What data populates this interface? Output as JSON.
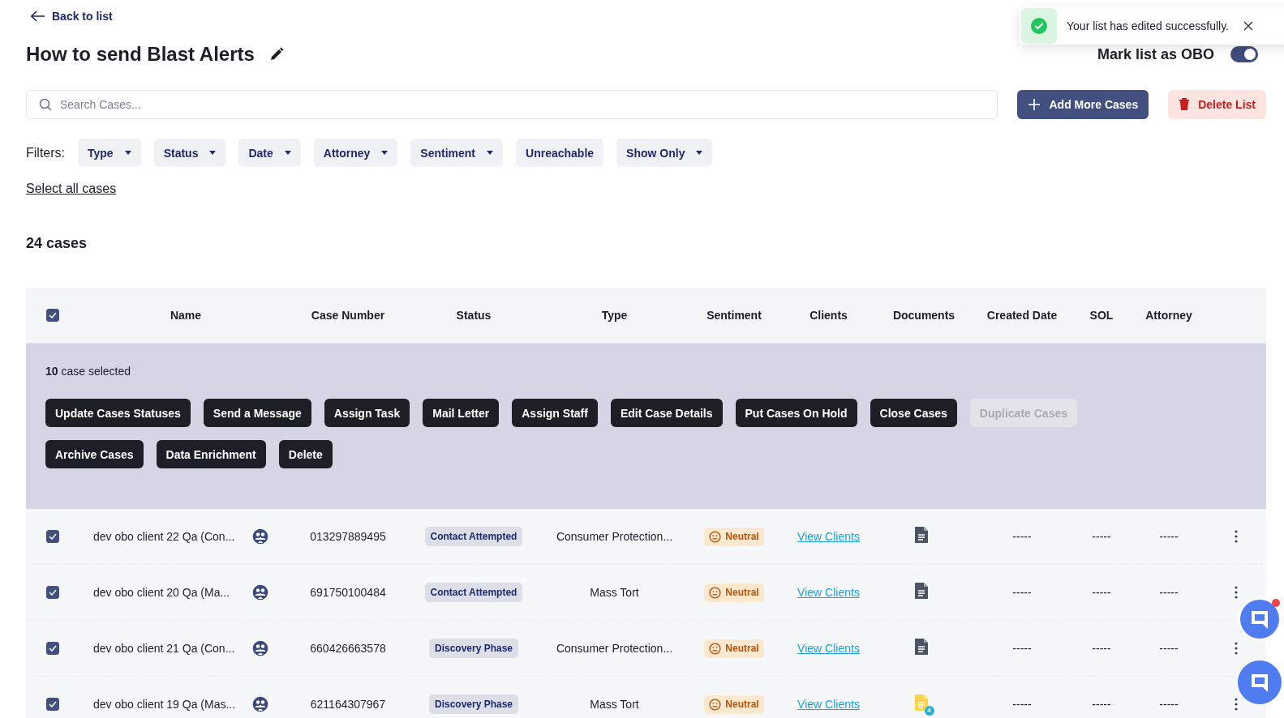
{
  "back_link": "Back to list",
  "title": "How to send Blast Alerts",
  "obo_toggle": {
    "label": "Mark list as OBO",
    "on": true
  },
  "toast": {
    "message": "Your list has edited successfully."
  },
  "search": {
    "placeholder": "Search Cases..."
  },
  "actions": [
    {
      "label": "Add More Cases",
      "kind": "primary"
    },
    {
      "label": "Delete List",
      "kind": "danger"
    }
  ],
  "filters_label": "Filters:",
  "filters": [
    {
      "label": "Type",
      "dropdown": true
    },
    {
      "label": "Status",
      "dropdown": true
    },
    {
      "label": "Date",
      "dropdown": true
    },
    {
      "label": "Attorney",
      "dropdown": true
    },
    {
      "label": "Sentiment",
      "dropdown": true
    },
    {
      "label": "Unreachable",
      "dropdown": false
    },
    {
      "label": "Show Only",
      "dropdown": true
    }
  ],
  "select_all": "Select all cases",
  "case_count": "24 cases",
  "table": {
    "header_checked": true,
    "columns": [
      "Name",
      "Case Number",
      "Status",
      "Type",
      "Sentiment",
      "Clients",
      "Documents",
      "Created Date",
      "SOL",
      "Attorney"
    ],
    "bulk": {
      "summary": "**10** case selected",
      "buttons": [
        {
          "label": "Update Cases Statuses",
          "disabled": false
        },
        {
          "label": "Send a Message",
          "disabled": false
        },
        {
          "label": "Assign Task",
          "disabled": false
        },
        {
          "label": "Mail Letter",
          "disabled": false
        },
        {
          "label": "Assign Staff",
          "disabled": false
        },
        {
          "label": "Edit Case Details",
          "disabled": false
        },
        {
          "label": "Put Cases On Hold",
          "disabled": false
        },
        {
          "label": "Close Cases",
          "disabled": false
        },
        {
          "label": "Duplicate Cases",
          "disabled": true
        },
        {
          "label": "Archive Cases",
          "disabled": false
        },
        {
          "label": "Data Enrichment",
          "disabled": false
        },
        {
          "label": "Delete",
          "disabled": false
        }
      ]
    },
    "rows": [
      {
        "checked": true,
        "name": "dev obo client 22 Qa (Con...",
        "case_number": "013297889495",
        "status": "Contact Attempted",
        "type": "Consumer Protection...",
        "sentiment": "Neutral",
        "clients": "View Clients",
        "created": "-----",
        "sol": "-----",
        "attorney": "-----"
      },
      {
        "checked": true,
        "name": "dev obo client 20 Qa (Ma...",
        "case_number": "691750100484",
        "status": "Contact Attempted",
        "type": "Mass Tort",
        "sentiment": "Neutral",
        "clients": "View Clients",
        "created": "-----",
        "sol": "-----",
        "attorney": "-----"
      },
      {
        "checked": true,
        "name": "dev obo client 21 Qa (Con...",
        "case_number": "660426663578",
        "status": "Discovery Phase",
        "type": "Consumer Protection...",
        "sentiment": "Neutral",
        "clients": "View Clients",
        "created": "-----",
        "sol": "-----",
        "attorney": "-----"
      },
      {
        "checked": true,
        "name": "dev obo client 19 Qa (Mas...",
        "case_number": "621164307967",
        "status": "Discovery Phase",
        "type": "Mass Tort",
        "sentiment": "Neutral",
        "clients": "View Clients",
        "document_count": "4",
        "created": "-----",
        "sol": "-----",
        "attorney": "-----"
      }
    ]
  }
}
